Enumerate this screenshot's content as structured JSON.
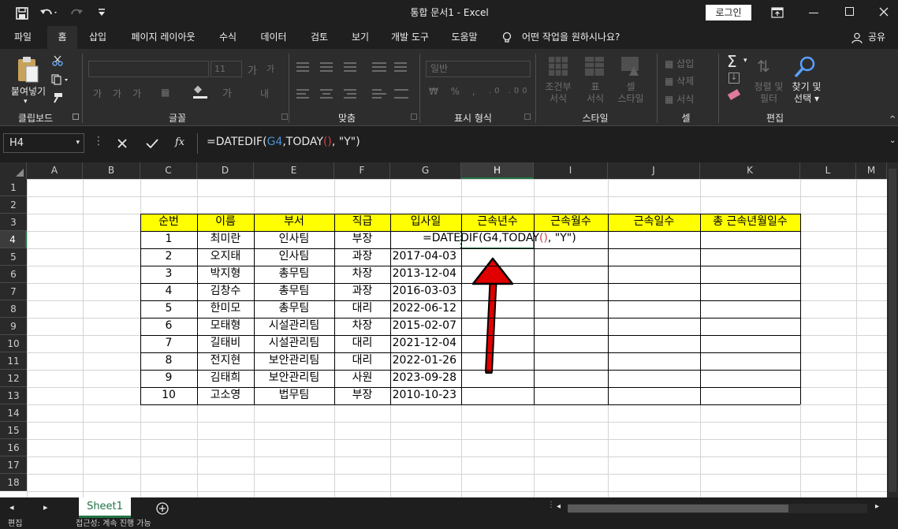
{
  "window": {
    "title": "통합 문서1  -  Excel",
    "login_label": "로그인"
  },
  "tabs": [
    {
      "label": "파일"
    },
    {
      "label": "홈"
    },
    {
      "label": "삽입"
    },
    {
      "label": "페이지 레이아웃"
    },
    {
      "label": "수식"
    },
    {
      "label": "데이터"
    },
    {
      "label": "검토"
    },
    {
      "label": "보기"
    },
    {
      "label": "개발 도구"
    },
    {
      "label": "도움말"
    }
  ],
  "tell_me": "어떤 작업을 원하시나요?",
  "share_label": "공유",
  "ribbon": {
    "clipboard": {
      "label": "클립보드",
      "paste": "붙여넣기"
    },
    "font": {
      "label": "글꼴",
      "size": "11"
    },
    "alignment": {
      "label": "맞춤"
    },
    "number": {
      "label": "표시 형식",
      "format": "일반"
    },
    "styles": {
      "label": "스타일",
      "cond1": "조건부",
      "cond2": "서식",
      "table1": "표",
      "table2": "서식",
      "cell1": "셀",
      "cell2": "스타일"
    },
    "cells": {
      "label": "셀",
      "insert": "삽입",
      "delete": "삭제",
      "format": "서식"
    },
    "editing": {
      "label": "편집",
      "sort1": "정렬 및",
      "sort2": "필터",
      "find1": "찾기 및",
      "find2": "선택"
    }
  },
  "formula_bar": {
    "name_box": "H4",
    "fx": "fx",
    "formula_parts": [
      "=DATEDIF(",
      "G4",
      ",TODAY",
      "()",
      ", \"Y\")"
    ]
  },
  "columns": [
    "A",
    "B",
    "C",
    "D",
    "E",
    "F",
    "G",
    "H",
    "I",
    "J",
    "K",
    "L",
    "M"
  ],
  "rows": [
    "1",
    "2",
    "3",
    "4",
    "5",
    "6",
    "7",
    "8",
    "9",
    "10",
    "11",
    "12",
    "13",
    "14",
    "15",
    "16",
    "17",
    "18"
  ],
  "table": {
    "headers": [
      "순번",
      "이름",
      "부서",
      "직급",
      "입사일",
      "근속년수",
      "근속월수",
      "근속일수",
      "총 근속년월일수"
    ],
    "rows": [
      [
        "1",
        "최미란",
        "인사팀",
        "부장",
        ""
      ],
      [
        "2",
        "오지태",
        "인사팀",
        "과장",
        "2017-04-03"
      ],
      [
        "3",
        "박지형",
        "총무팀",
        "차장",
        "2013-12-04"
      ],
      [
        "4",
        "김창수",
        "총무팀",
        "과장",
        "2016-03-03"
      ],
      [
        "5",
        "한미모",
        "총무팀",
        "대리",
        "2022-06-12"
      ],
      [
        "6",
        "모태형",
        "시설관리팀",
        "차장",
        "2015-02-07"
      ],
      [
        "7",
        "길태비",
        "시설관리팀",
        "대리",
        "2021-12-04"
      ],
      [
        "8",
        "전지현",
        "보안관리팀",
        "대리",
        "2022-01-26"
      ],
      [
        "9",
        "김태희",
        "보안관리팀",
        "사원",
        "2023-09-28"
      ],
      [
        "10",
        "고소영",
        "법무팀",
        "부장",
        "2010-10-23"
      ]
    ],
    "edit_formula_parts": [
      "=DATEDIF(G4,TODAY",
      "()",
      ", \"Y\")"
    ]
  },
  "sheet_tab": "Sheet1",
  "status": {
    "mode": "편집",
    "extra": "접근성: 계속 진행 가능"
  },
  "colors": {
    "header_fill": "#ffff00",
    "accent_green": "#217346",
    "arrow_red": "#e00000",
    "ref_blue": "#4a8fd6",
    "paren_red": "#c0392b"
  }
}
